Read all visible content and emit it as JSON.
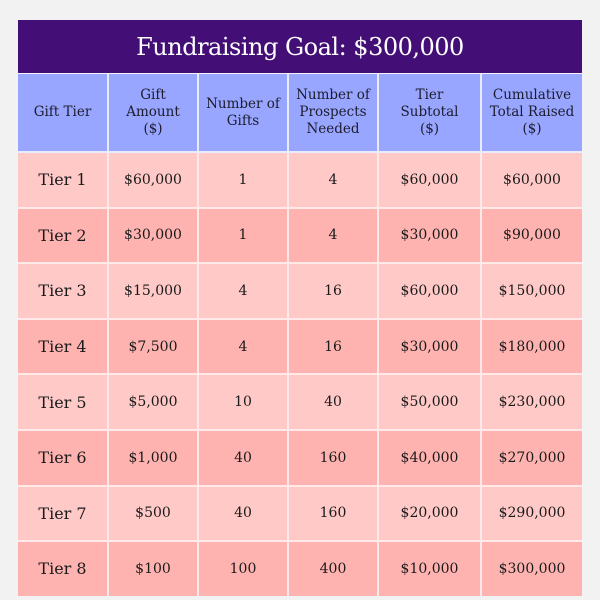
{
  "title": "Fundraising Goal: $300,000",
  "headers": [
    "Gift Tier",
    "Gift Amount ($)",
    "Number of Gifts",
    "Number of Prospects Needed",
    "Tier Subtotal ($)",
    "Cumulative Total Raised ($)"
  ],
  "rows": [
    [
      "Tier 1",
      "$60,000",
      "1",
      "4",
      "$60,000",
      "$60,000"
    ],
    [
      "Tier 2",
      "$30,000",
      "1",
      "4",
      "$30,000",
      "$90,000"
    ],
    [
      "Tier 3",
      "$15,000",
      "4",
      "16",
      "$60,000",
      "$150,000"
    ],
    [
      "Tier 4",
      "$7,500",
      "4",
      "16",
      "$30,000",
      "$180,000"
    ],
    [
      "Tier 5",
      "$5,000",
      "10",
      "40",
      "$50,000",
      "$230,000"
    ],
    [
      "Tier 6",
      "$1,000",
      "40",
      "160",
      "$40,000",
      "$270,000"
    ],
    [
      "Tier 7",
      "$500",
      "40",
      "160",
      "$20,000",
      "$290,000"
    ],
    [
      "Tier 8",
      "$100",
      "100",
      "400",
      "$10,000",
      "$300,000"
    ]
  ],
  "colors": {
    "title_bg": "#440e77",
    "header_bg": "#98a6ff",
    "row_light": "#ffc9c7",
    "row_dark": "#ffb3b0",
    "page_bg": "#f2f2f2"
  }
}
